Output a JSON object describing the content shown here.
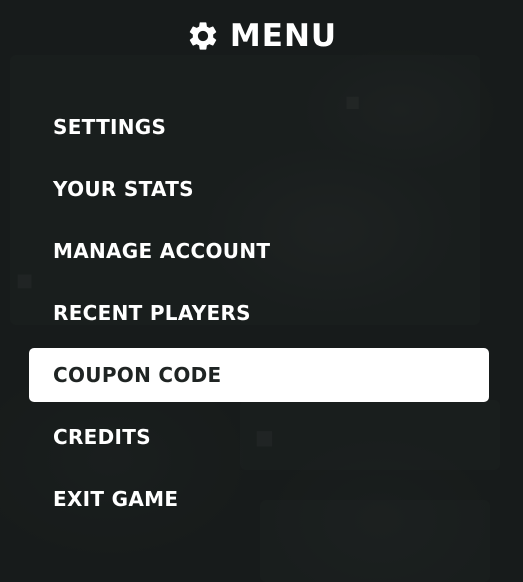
{
  "header": {
    "icon": "gear-icon",
    "title": "MENU"
  },
  "menu": {
    "items": [
      {
        "label": "SETTINGS"
      },
      {
        "label": "YOUR STATS"
      },
      {
        "label": "MANAGE ACCOUNT"
      },
      {
        "label": "RECENT PLAYERS"
      },
      {
        "label": "COUPON CODE"
      },
      {
        "label": "CREDITS"
      },
      {
        "label": "EXIT GAME"
      }
    ],
    "selected_label": "COUPON CODE"
  },
  "colors": {
    "background": "#1f2423",
    "text": "#ffffff",
    "selected_background": "#ffffff",
    "selected_text": "#1f2423"
  }
}
